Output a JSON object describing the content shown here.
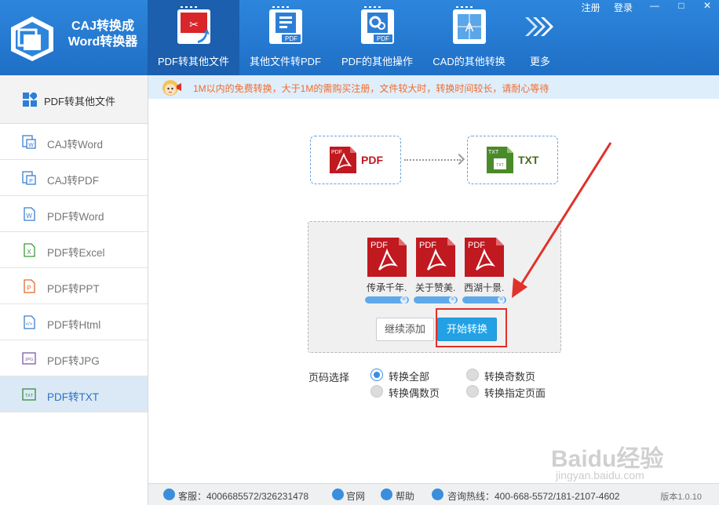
{
  "app": {
    "title_line1": "CAJ转换成",
    "title_line2": "Word转换器",
    "top_links": [
      "注册",
      "登录"
    ],
    "window_controls": [
      "—",
      "□",
      "✕"
    ]
  },
  "nav": {
    "tabs": [
      {
        "label": "PDF转其他文件",
        "icon": "pdf-export-icon",
        "active": true
      },
      {
        "label": "其他文件转PDF",
        "icon": "file-to-pdf-icon",
        "active": false
      },
      {
        "label": "PDF的其他操作",
        "icon": "pdf-settings-icon",
        "active": false
      },
      {
        "label": "CAD的其他转换",
        "icon": "cad-convert-icon",
        "active": false
      },
      {
        "label": "更多",
        "icon": "more-arrows-icon",
        "active": false
      }
    ]
  },
  "sidebar": {
    "header": "PDF转其他文件",
    "items": [
      {
        "label": "CAJ转Word",
        "icon": "caj-word-icon",
        "color": "#3b7fd0",
        "active": false
      },
      {
        "label": "CAJ转PDF",
        "icon": "caj-pdf-icon",
        "color": "#3b7fd0",
        "active": false
      },
      {
        "label": "PDF转Word",
        "icon": "word-icon",
        "color": "#3b7fd0",
        "active": false
      },
      {
        "label": "PDF转Excel",
        "icon": "excel-icon",
        "color": "#3a9a3a",
        "active": false
      },
      {
        "label": "PDF转PPT",
        "icon": "ppt-icon",
        "color": "#e06a2a",
        "active": false
      },
      {
        "label": "PDF转Html",
        "icon": "html-icon",
        "color": "#3b7fd0",
        "active": false
      },
      {
        "label": "PDF转JPG",
        "icon": "jpg-icon",
        "color": "#7a5aa8",
        "active": false
      },
      {
        "label": "PDF转TXT",
        "icon": "txt-icon",
        "color": "#3a8a3a",
        "active": true
      }
    ]
  },
  "notice": {
    "text": "1M以内的免费转换，大于1M的需购买注册，文件较大时，转换时间较长，请耐心等待"
  },
  "conversion": {
    "from_label": "PDF",
    "from_badge": "PDF",
    "to_label": "TXT",
    "to_badge": "TXT"
  },
  "files": [
    {
      "name": "传承千年.",
      "badge": "PDF",
      "progress": 1.0
    },
    {
      "name": "关于赞美.",
      "badge": "PDF",
      "progress": 1.0
    },
    {
      "name": "西湖十景.",
      "badge": "PDF",
      "progress": 1.0
    }
  ],
  "buttons": {
    "add": "继续添加",
    "start": "开始转换"
  },
  "page_select": {
    "label": "页码选择",
    "options": [
      {
        "label": "转换全部",
        "checked": true
      },
      {
        "label": "转换奇数页",
        "checked": false
      },
      {
        "label": "转换偶数页",
        "checked": false
      },
      {
        "label": "转换指定页面",
        "checked": false
      }
    ]
  },
  "footer": {
    "service": "客服：4006685572/326231478",
    "website": "官网",
    "help": "帮助",
    "hotline": "咨询热线：400-668-5572/181-2107-4602",
    "version": "版本1.0.10"
  },
  "watermark": {
    "line1": "Baidu经验",
    "line2": "jingyan.baidu.com"
  },
  "colors": {
    "header_blue": "#2d86dc",
    "active_tab": "#1b5fae",
    "accent_red": "#e0322b",
    "notice_text": "#f06b2d",
    "start_button": "#23a1e5",
    "pdf_red": "#c01920",
    "txt_green": "#4a8a2a"
  }
}
